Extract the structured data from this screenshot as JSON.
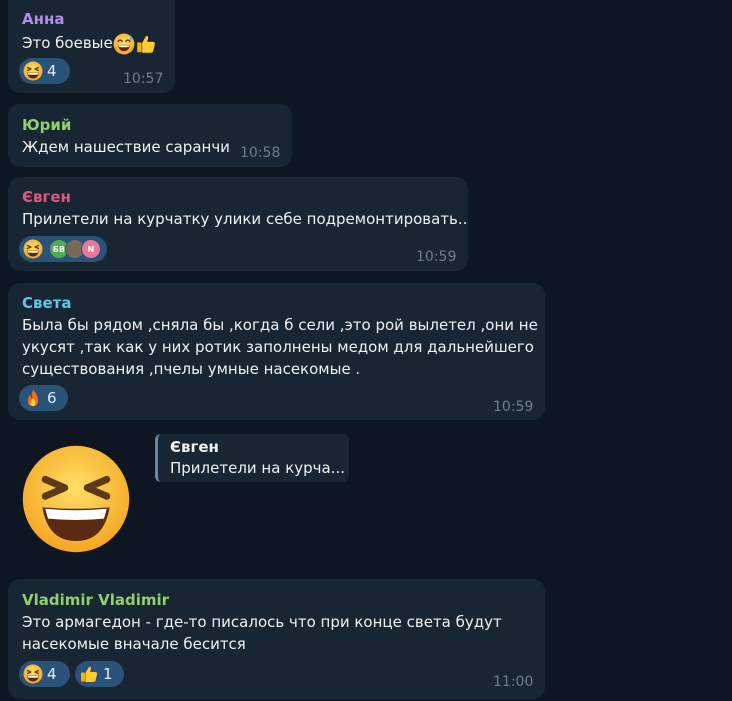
{
  "messages": [
    {
      "sender": "Анна",
      "text": "Это боевые",
      "time": "10:57",
      "reaction_count": "4"
    },
    {
      "sender": "Юрий",
      "text": "Ждем нашествие саранчи",
      "time": "10:58"
    },
    {
      "sender": "Євген",
      "text": "Прилетели на курчатку улики себе подремонтировать..",
      "time": "10:59",
      "avatars": [
        "БВ",
        "",
        "N"
      ]
    },
    {
      "sender": "Света",
      "lines": [
        "Была бы рядом ,сняла бы ,когда б сели ,это рой вылетел ,они не",
        "укусят ,так как у них ротик заполнены медом для дальнейшего",
        "существования ,пчелы умные насекомые ."
      ],
      "time": "10:59",
      "reaction_count": "6"
    },
    {
      "reply_sender": "Євген",
      "reply_text": "Прилетели на курча..."
    },
    {
      "sender": "Vladimir Vladimir",
      "lines": [
        "Это армагедон - где-то писалось что при конце света будут",
        "насекомые вначале бесится"
      ],
      "time": "11:00",
      "reactions": [
        {
          "icon": "grinning-squint-icon",
          "count": "4"
        },
        {
          "icon": "thumbs-up-icon",
          "count": "1"
        }
      ]
    }
  ],
  "colors": {
    "anna": "#b58ce6",
    "yuri": "#8fd16b",
    "evgen": "#e0577e",
    "sveta": "#5cc9e6",
    "vladimir": "#8fd16b",
    "bubble": "#182533",
    "reaction": "#2b5278"
  }
}
